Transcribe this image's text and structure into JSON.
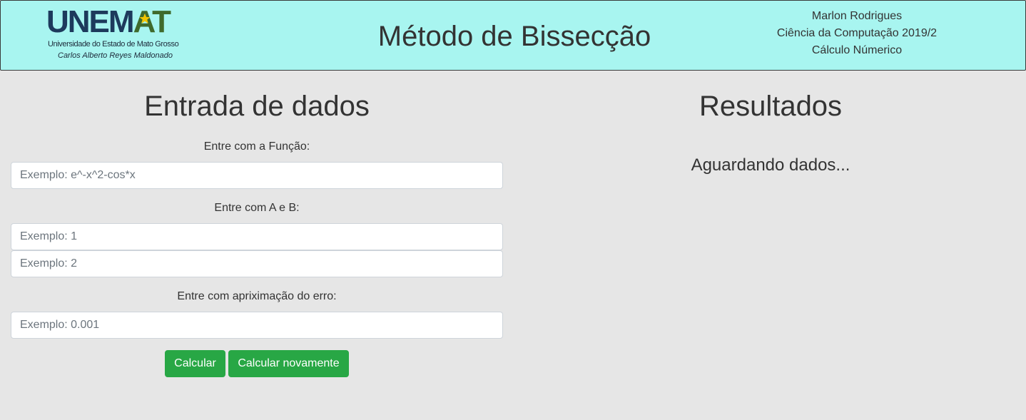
{
  "header": {
    "logo": {
      "word_part1": "UNEMAT",
      "word_part2": "",
      "university": "Universidade do Estado de Mato Grosso",
      "campus": "Carlos Alberto Reyes Maldonado",
      "colors": {
        "dark": "#1d3a5c",
        "green": "#3f6a2c",
        "star": "#f2c400"
      }
    },
    "title": "Método de Bissecção",
    "author": "Marlon Rodrigues",
    "course": "Ciência da Computação 2019/2",
    "subject": "Cálculo Númerico",
    "background_color": "#a8f5f0"
  },
  "input_section": {
    "title": "Entrada de dados",
    "function_label": "Entre com a Função:",
    "function_field": {
      "value": "",
      "placeholder": "Exemplo: e^-x^2-cos*x"
    },
    "ab_label": "Entre com A e B:",
    "a_field": {
      "value": "",
      "placeholder": "Exemplo: 1"
    },
    "b_field": {
      "value": "",
      "placeholder": "Exemplo: 2"
    },
    "error_label": "Entre com apriximação do erro:",
    "error_field": {
      "value": "",
      "placeholder": "Exemplo: 0.001"
    },
    "calculate_button": "Calcular",
    "recalculate_button": "Calcular novamente",
    "button_color": "#28a745"
  },
  "results_section": {
    "title": "Resultados",
    "status": "Aguardando dados..."
  }
}
